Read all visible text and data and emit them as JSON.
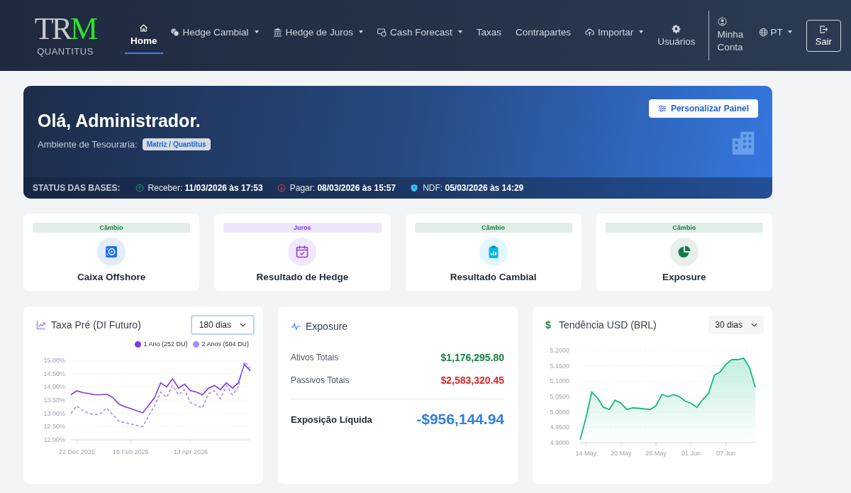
{
  "logo": {
    "mark_left": "TR",
    "mark_right": "M",
    "subtitle": "QUANTITUS"
  },
  "nav": [
    {
      "label": "Home",
      "kind": "home",
      "dropdown": false,
      "selected": true,
      "stacked": true
    },
    {
      "label": "Hedge Cambial",
      "kind": "coins",
      "dropdown": true,
      "selected": false,
      "stacked": false
    },
    {
      "label": "Hedge de Juros",
      "kind": "bank",
      "dropdown": true,
      "selected": false,
      "stacked": false
    },
    {
      "label": "Cash Forecast",
      "kind": "cash",
      "dropdown": true,
      "selected": false,
      "stacked": false
    },
    {
      "label": "Taxas",
      "kind": "plain",
      "dropdown": false,
      "selected": false,
      "stacked": false
    },
    {
      "label": "Contrapartes",
      "kind": "plain",
      "dropdown": false,
      "selected": false,
      "stacked": false
    },
    {
      "label": "Importar",
      "kind": "cloud",
      "dropdown": true,
      "selected": false,
      "stacked": false
    },
    {
      "label": "Usuários",
      "kind": "gear",
      "dropdown": false,
      "selected": false,
      "stacked": true
    }
  ],
  "account": {
    "label": "Minha Conta"
  },
  "language": {
    "label": "PT"
  },
  "logout": {
    "label": "Sair"
  },
  "hero": {
    "greeting": "Olá, Administrador.",
    "env_label": "Ambiente de Tesouraria:",
    "env_badge": "Matriz / Quantitus",
    "customize_button": "Personalizar Painel",
    "status_title": "STATUS DAS BASES:",
    "status": [
      {
        "kind": "up",
        "label": "Receber:",
        "value": "11/03/2026 às 17:53"
      },
      {
        "kind": "down",
        "label": "Pagar:",
        "value": "08/03/2026 às 15:57"
      },
      {
        "kind": "shield",
        "label": "NDF:",
        "value": "05/03/2026 às 14:29"
      }
    ]
  },
  "shortcuts": [
    {
      "tag": "Câmbio",
      "color": "#1b7a4c",
      "kind": "safe",
      "title": "Caixa Offshore"
    },
    {
      "tag": "Juros",
      "color": "#7c3aed",
      "kind": "calendar",
      "title": "Resultado de Hedge"
    },
    {
      "tag": "Câmbio",
      "color": "#1b7a4c",
      "kind": "clipboard",
      "title": "Resultado Cambial"
    },
    {
      "tag": "Câmbio",
      "color": "#1b7a4c",
      "kind": "pie",
      "title": "Exposure"
    }
  ],
  "rate_panel": {
    "title": "Taxa Pré (DI Futuro)",
    "period": "180 dias",
    "chart_data": {
      "type": "line",
      "categories": [
        null,
        "22 Dec 2025",
        null,
        null,
        null,
        null,
        null,
        null,
        null,
        null,
        "16 Feb 2026",
        null,
        null,
        null,
        null,
        null,
        null,
        null,
        null,
        null,
        "13 Apr 2026",
        null,
        null,
        null,
        null,
        null,
        null,
        null,
        null,
        null,
        null
      ],
      "grid": true,
      "series": [
        {
          "name": "1 Ano (252 DU)",
          "color": "#7c3aed",
          "line_style": "solid",
          "values": [
            13.7,
            13.85,
            13.78,
            13.75,
            13.7,
            13.7,
            13.72,
            13.6,
            13.35,
            13.25,
            13.18,
            13.1,
            13.02,
            13.3,
            13.6,
            14.15,
            14.0,
            14.3,
            13.95,
            14.1,
            13.85,
            13.8,
            13.7,
            13.95,
            14.05,
            13.9,
            14.15,
            13.95,
            14.15,
            14.85,
            14.6
          ]
        },
        {
          "name": "2 Anos (504 DU)",
          "color": "#a78bfa",
          "line_style": "dashed",
          "values": [
            13.0,
            13.28,
            13.1,
            13.0,
            12.95,
            13.0,
            13.2,
            12.95,
            12.7,
            12.65,
            12.6,
            12.55,
            12.5,
            12.9,
            13.3,
            13.8,
            13.6,
            14.05,
            13.7,
            13.9,
            13.4,
            13.3,
            13.2,
            13.75,
            13.85,
            13.55,
            14.05,
            13.7,
            14.0,
            14.95,
            14.7
          ]
        }
      ],
      "ylim": [
        12,
        15
      ],
      "yticks": [
        {
          "value": 12,
          "label": "12.00%"
        },
        {
          "value": 12.5,
          "label": "12.50%"
        },
        {
          "value": 13,
          "label": "13.00%"
        },
        {
          "value": 13.5,
          "label": "13.50%"
        },
        {
          "value": 14,
          "label": "14.00%"
        },
        {
          "value": 14.5,
          "label": "14.50%"
        },
        {
          "value": 15,
          "label": "15.00%"
        }
      ]
    }
  },
  "exposure_panel": {
    "title": "Exposure",
    "rows": [
      {
        "label": "Ativos Totais",
        "value": "$1,176,295.80",
        "color": "#15803d"
      },
      {
        "label": "Passivos Totais",
        "value": "$2,583,320.45",
        "color": "#dc2626"
      }
    ],
    "total_label": "Exposição Líquida",
    "total_value": "-$956,144.94"
  },
  "usd_panel": {
    "symbol": "$",
    "title": "Tendência USD (BRL)",
    "period": "30 dias",
    "chart_data": {
      "type": "area",
      "categories": [
        null,
        "14 May",
        null,
        null,
        null,
        null,
        null,
        "20 May",
        null,
        null,
        null,
        null,
        null,
        "26 May",
        null,
        null,
        null,
        null,
        null,
        "01 Jun",
        null,
        null,
        null,
        null,
        null,
        "07 Jun",
        null,
        null,
        null,
        null,
        null
      ],
      "grid": true,
      "series": [
        {
          "color": "#10b981",
          "line_style": "solid",
          "values": [
            4.91,
            4.98,
            5.065,
            5.045,
            5.015,
            5.008,
            5.038,
            5.028,
            5.008,
            5.013,
            5.012,
            5.01,
            5.008,
            5.02,
            5.057,
            5.05,
            5.056,
            5.05,
            5.035,
            5.028,
            5.015,
            5.04,
            5.06,
            5.12,
            5.13,
            5.155,
            5.17,
            5.17,
            5.175,
            5.145,
            5.08
          ]
        }
      ],
      "ylim": [
        4.9,
        5.2
      ],
      "yticks": [
        {
          "value": 4.9,
          "label": "4.9000"
        },
        {
          "value": 4.95,
          "label": "4.9500"
        },
        {
          "value": 5.0,
          "label": "5.0000"
        },
        {
          "value": 5.05,
          "label": "5.0500"
        },
        {
          "value": 5.1,
          "label": "5.1000"
        },
        {
          "value": 5.15,
          "label": "5.1500"
        },
        {
          "value": 5.2,
          "label": "5.2000"
        }
      ]
    }
  }
}
